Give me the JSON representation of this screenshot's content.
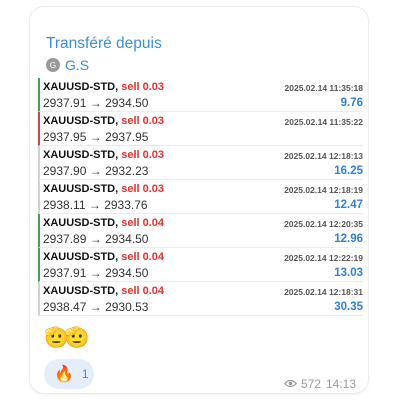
{
  "forward": {
    "title": "Transféré depuis",
    "author": "G.S",
    "author_initial": "G"
  },
  "trades": [
    {
      "symbol": "XAUUSD-STD,",
      "side": "sell 0.03",
      "open": "2937.91",
      "close": "2934.50",
      "time": "2025.02.14 11:35:18",
      "profit": "9.76",
      "marker": "green"
    },
    {
      "symbol": "XAUUSD-STD,",
      "side": "sell 0.03",
      "open": "2937.95",
      "close": "2937.95",
      "time": "2025.02.14 11:35:22",
      "profit": "",
      "marker": "red"
    },
    {
      "symbol": "XAUUSD-STD,",
      "side": "sell 0.03",
      "open": "2937.90",
      "close": "2932.23",
      "time": "2025.02.14 12:18:13",
      "profit": "16.25",
      "marker": "none"
    },
    {
      "symbol": "XAUUSD-STD,",
      "side": "sell 0.03",
      "open": "2938.11",
      "close": "2933.76",
      "time": "2025.02.14 12:18:19",
      "profit": "12.47",
      "marker": "none"
    },
    {
      "symbol": "XAUUSD-STD,",
      "side": "sell 0.04",
      "open": "2937.89",
      "close": "2934.50",
      "time": "2025.02.14 12:20:35",
      "profit": "12.96",
      "marker": "green"
    },
    {
      "symbol": "XAUUSD-STD,",
      "side": "sell 0.04",
      "open": "2937.91",
      "close": "2934.50",
      "time": "2025.02.14 12:22:19",
      "profit": "13.03",
      "marker": "green"
    },
    {
      "symbol": "XAUUSD-STD,",
      "side": "sell 0.04",
      "open": "2938.47",
      "close": "2930.53",
      "time": "2025.02.14 12:18:31",
      "profit": "30.35",
      "marker": "none"
    }
  ],
  "arrow": "→",
  "emojis": "🫡🫡",
  "reaction": {
    "emoji": "🔥",
    "count": "1"
  },
  "meta": {
    "views": "572",
    "time": "14:13"
  },
  "colors": {
    "link": "#3c8ed6",
    "profit": "#2f80d6",
    "sell": "#e03030",
    "marker_green": "#3ea54a",
    "marker_red": "#d64545"
  }
}
